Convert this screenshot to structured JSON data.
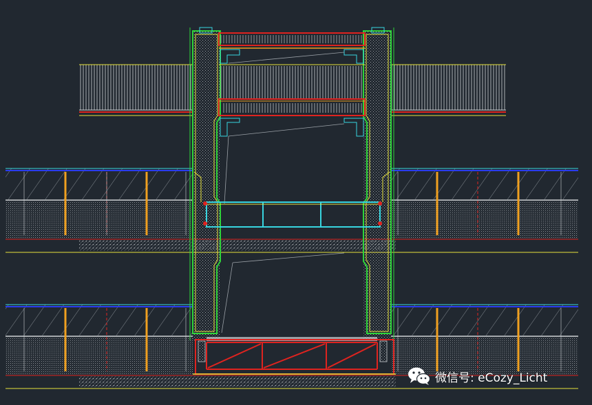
{
  "watermark": {
    "text": "微信号: eCozy_Licht",
    "icon": "wechat-icon"
  },
  "colors": {
    "background": "#212830",
    "frame_green": "#2fd43a",
    "ceiling_yellow": "#e8e23c",
    "rail_red": "#e0231f",
    "glass_cyan": "#38d6e0",
    "stone_white": "#cfd3d6",
    "floor_blue": "#2a3df0",
    "post_orange": "#f0a020",
    "hatch_grey": "#8a8f95"
  }
}
